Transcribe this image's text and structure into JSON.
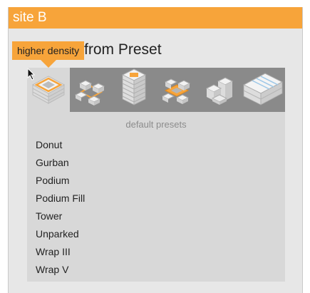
{
  "header": {
    "title": "site B"
  },
  "section": {
    "title": "from Preset"
  },
  "tooltip": {
    "text": "higher density"
  },
  "strip": {
    "icons": [
      {
        "name": "donut-preset-icon",
        "selected": true
      },
      {
        "name": "gurban-preset-icon",
        "selected": false
      },
      {
        "name": "tower-preset-icon",
        "selected": false
      },
      {
        "name": "wrap-preset-icon",
        "selected": false
      },
      {
        "name": "podium-preset-icon",
        "selected": false
      },
      {
        "name": "unparked-preset-icon",
        "selected": false
      }
    ]
  },
  "presets": {
    "label": "default presets",
    "items": [
      "Donut",
      "Gurban",
      "Podium",
      "Podium Fill",
      "Tower",
      "Unparked",
      "Wrap III",
      "Wrap V"
    ]
  },
  "colors": {
    "accent": "#f7a43a",
    "panel": "#e7e7e7",
    "strip": "#8a8a8a",
    "list_bg": "#d8d8d8"
  }
}
